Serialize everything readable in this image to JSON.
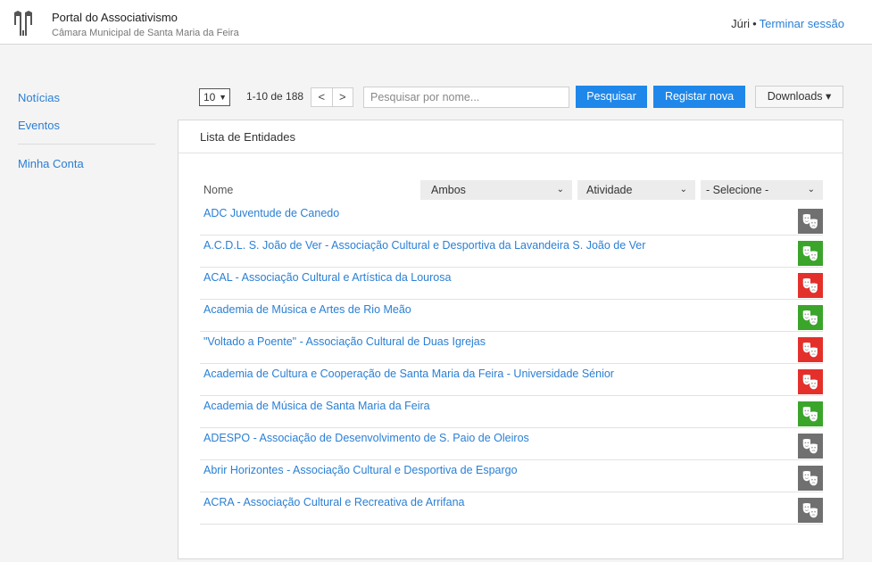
{
  "header": {
    "title": "Portal do Associativismo",
    "subtitle": "Câmara Municipal de Santa Maria da Feira",
    "user": "Júri",
    "separator": "•",
    "logout": "Terminar sessão"
  },
  "sidebar": {
    "items": [
      {
        "label": "Notícias"
      },
      {
        "label": "Eventos"
      },
      {
        "label": "Minha Conta"
      }
    ]
  },
  "toolbar": {
    "per_page": "10",
    "range": "1-10 de 188",
    "prev": "<",
    "next": ">",
    "search_placeholder": "Pesquisar por nome...",
    "search_button": "Pesquisar",
    "register_button": "Registar nova",
    "downloads_button": "Downloads ▾"
  },
  "panel": {
    "title": "Lista de Entidades",
    "column_name": "Nome",
    "filter_type": "Ambos",
    "filter_activity": "Atividade",
    "filter_select": "- Selecione -"
  },
  "colors": {
    "accent": "#1f87ea",
    "link": "#2a7fd4",
    "status_grey": "#707070",
    "status_green": "#3aa52a",
    "status_red": "#e4302b"
  },
  "entities": [
    {
      "name": "ADC Juventude de Canedo",
      "status": "grey",
      "icon": "theater-masks-icon"
    },
    {
      "name": "A.C.D.L. S. João de Ver - Associação Cultural e Desportiva da Lavandeira S. João de Ver",
      "status": "green",
      "icon": "theater-masks-icon"
    },
    {
      "name": "ACAL - Associação Cultural e Artística da Lourosa",
      "status": "red",
      "icon": "theater-masks-icon"
    },
    {
      "name": "Academia de Música e Artes de Rio Meão",
      "status": "green",
      "icon": "theater-masks-icon"
    },
    {
      "name": "\"Voltado a Poente\" - Associação Cultural de Duas Igrejas",
      "status": "red",
      "icon": "theater-masks-icon"
    },
    {
      "name": "Academia de Cultura e Cooperação de Santa Maria da Feira - Universidade Sénior",
      "status": "red",
      "icon": "theater-masks-icon"
    },
    {
      "name": "Academia de Música de Santa Maria da Feira",
      "status": "green",
      "icon": "theater-masks-icon"
    },
    {
      "name": "ADESPO - Associação de Desenvolvimento de S. Paio de Oleiros",
      "status": "grey",
      "icon": "theater-masks-icon"
    },
    {
      "name": "Abrir Horizontes - Associação Cultural e Desportiva de Espargo",
      "status": "grey",
      "icon": "theater-masks-icon"
    },
    {
      "name": "ACRA - Associação Cultural e Recreativa de Arrifana",
      "status": "grey",
      "icon": "theater-masks-icon"
    }
  ]
}
